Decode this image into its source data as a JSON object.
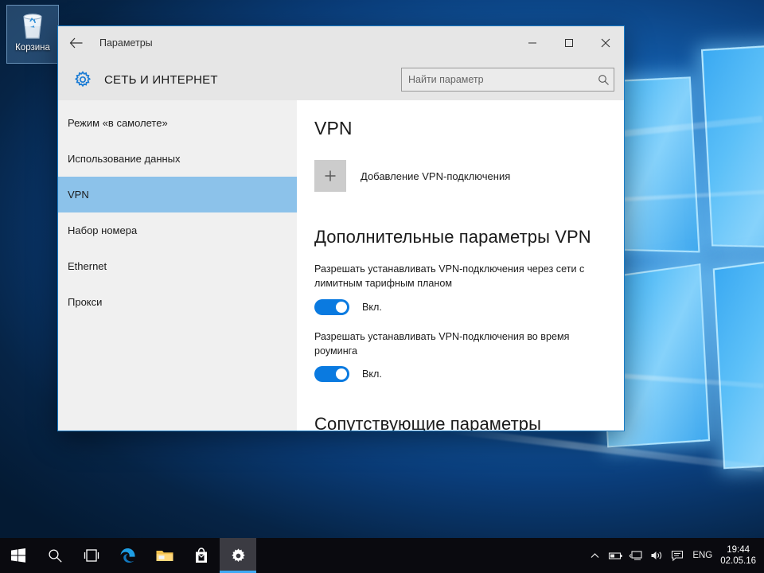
{
  "desktop": {
    "recycle_bin": {
      "label": "Корзина",
      "icon": "recycle-bin-icon"
    }
  },
  "window": {
    "titlebar": {
      "back_icon": "back-arrow-icon",
      "title": "Параметры",
      "minimize": "—",
      "maximize": "▢",
      "close": "✕"
    },
    "header": {
      "gear_icon": "gear-icon",
      "page_title": "СЕТЬ И ИНТЕРНЕТ",
      "search_placeholder": "Найти параметр",
      "search_value": "",
      "search_icon": "search-icon"
    },
    "sidebar": {
      "items": [
        {
          "label": "Режим «в самолете»",
          "selected": false
        },
        {
          "label": "Использование данных",
          "selected": false
        },
        {
          "label": "VPN",
          "selected": true
        },
        {
          "label": "Набор номера",
          "selected": false
        },
        {
          "label": "Ethernet",
          "selected": false
        },
        {
          "label": "Прокси",
          "selected": false
        }
      ],
      "selected_color": "#8cc2ea"
    },
    "content": {
      "heading": "VPN",
      "add_connection": {
        "icon": "plus-icon",
        "label": "Добавление VPN-подключения"
      },
      "advanced_heading": "Дополнительные параметры VPN",
      "settings": [
        {
          "description": "Разрешать устанавливать VPN-подключения через сети с лимитным тарифным планом",
          "toggle_state": "Вкл.",
          "toggle_on": true
        },
        {
          "description": "Разрешать устанавливать VPN-подключения во время роуминга",
          "toggle_state": "Вкл.",
          "toggle_on": true
        }
      ],
      "related_heading": "Сопутствующие параметры",
      "accent_color": "#0a7ae0"
    }
  },
  "taskbar": {
    "buttons": [
      {
        "name": "start-button",
        "icon": "windows-logo-icon"
      },
      {
        "name": "search-button",
        "icon": "search-icon"
      },
      {
        "name": "task-view-button",
        "icon": "task-view-icon"
      },
      {
        "name": "edge-button",
        "icon": "edge-browser-icon"
      },
      {
        "name": "file-explorer-button",
        "icon": "folder-icon"
      },
      {
        "name": "store-button",
        "icon": "store-bag-icon"
      },
      {
        "name": "settings-button",
        "icon": "gear-icon"
      }
    ],
    "tray": {
      "chevron": "show-hidden-icons-icon",
      "battery": "battery-icon",
      "network": "network-icon",
      "volume": "volume-icon",
      "action_center": "action-center-icon",
      "language": "ENG",
      "time": "19:44",
      "date": "02.05.16"
    }
  }
}
